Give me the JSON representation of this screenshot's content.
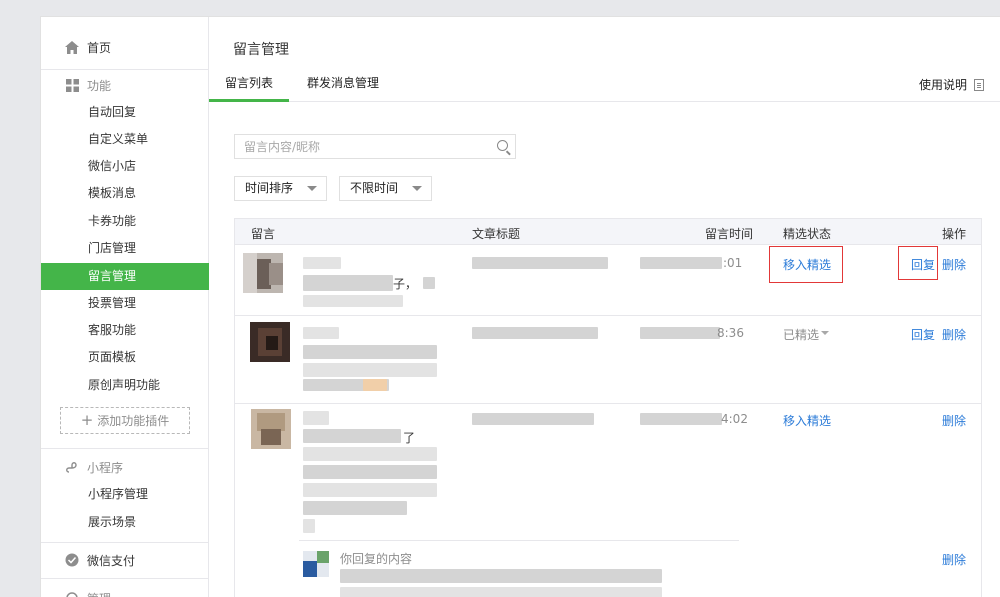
{
  "sidebar": {
    "home": "首页",
    "features_head": "功能",
    "feature_items": [
      "自动回复",
      "自定义菜单",
      "微信小店",
      "模板消息",
      "卡券功能",
      "门店管理",
      "留言管理",
      "投票管理",
      "客服功能",
      "页面模板",
      "原创声明功能"
    ],
    "active_item": "留言管理",
    "add_plugin": "添加功能插件",
    "mini_head": "小程序",
    "mini_items": [
      "小程序管理",
      "展示场景"
    ],
    "pay": "微信支付",
    "manage": "管理"
  },
  "main": {
    "title": "留言管理",
    "tabs": [
      "留言列表",
      "群发消息管理"
    ],
    "help": "使用说明",
    "search_placeholder": "留言内容/昵称",
    "sort_select": "时间排序",
    "time_select": "不限时间"
  },
  "table": {
    "headers": [
      "留言",
      "文章标题",
      "留言时间",
      "精选状态",
      "操作"
    ],
    "rows": [
      {
        "time_tail": ":01",
        "text_frag": "子，",
        "status": "移入精选",
        "actions": [
          "回复",
          "删除"
        ]
      },
      {
        "time_tail": "8:36",
        "text_frag": "",
        "status": "已精选",
        "actions": [
          "回复",
          "删除"
        ]
      },
      {
        "time_tail": "4:02",
        "text_frag": "了",
        "status": "移入精选",
        "actions": [
          "删除"
        ]
      }
    ],
    "reply": {
      "label": "你回复的内容",
      "action": "删除"
    }
  },
  "colors": {
    "accent_green": "#44b549",
    "link_blue": "#2b7bd8",
    "highlight_red": "#e23838"
  }
}
